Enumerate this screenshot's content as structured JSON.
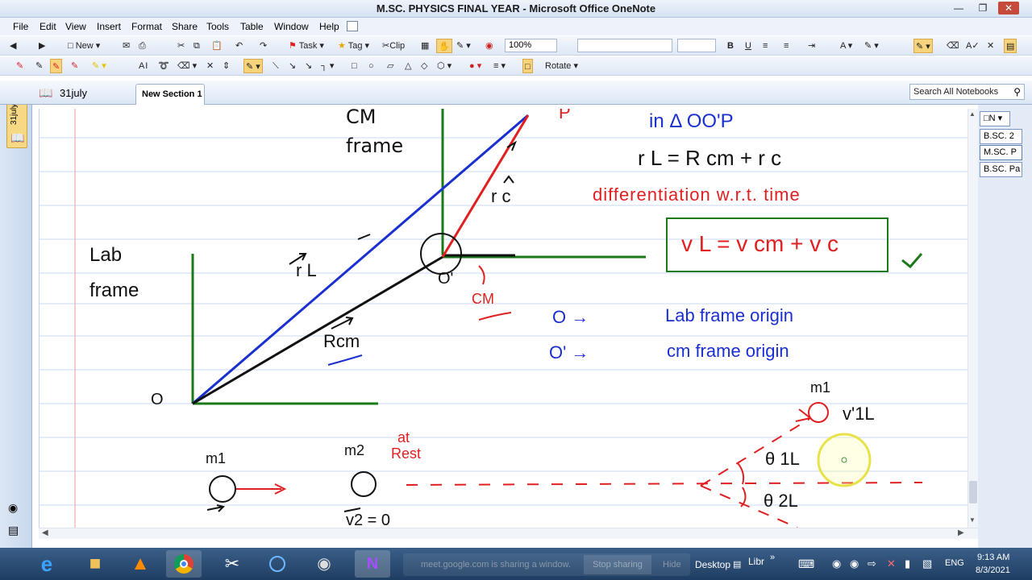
{
  "window": {
    "title": "M.SC. PHYSICS FINAL YEAR  - Microsoft Office OneNote"
  },
  "menu": [
    "File",
    "Edit",
    "View",
    "Insert",
    "Format",
    "Share",
    "Tools",
    "Table",
    "Window",
    "Help"
  ],
  "toolbar1": {
    "new_label": "New",
    "task_label": "Task",
    "tag_label": "Tag",
    "clip_label": "Clip",
    "zoom_value": "100%"
  },
  "toolbar2": {
    "rotate_label": "Rotate"
  },
  "notebook": {
    "name": "31july",
    "side_label": "31july"
  },
  "section_tab": "New Section 1",
  "search": {
    "placeholder": "Search All Notebooks"
  },
  "page_tabs": [
    "B.SC. 2",
    "M.SC. P",
    "B.SC. Pa"
  ],
  "page_tab_new": "N",
  "ink": {
    "cm_frame": [
      "CM",
      "frame"
    ],
    "lab_frame": [
      "Lab",
      "frame"
    ],
    "point_o": "O",
    "point_o_prime": "O'",
    "point_p": "P",
    "cm_label": "CM",
    "vec_rl": "r L",
    "vec_rc": "r c",
    "vec_rcm": "Rcm",
    "triangle_note": "in Δ OO'P",
    "eq_positions": "r L =  R cm  +  r c",
    "differentiation": "differentiation  w.r.t.  time",
    "eq_velocity": "v L =  v cm  +  v c",
    "legend_o": "O  →",
    "legend_o_text": "Lab frame origin",
    "legend_o1": "O'  →",
    "legend_o1_text": "cm frame origin",
    "m1": "m1",
    "m2": "m2",
    "at_rest": [
      "at",
      "Rest"
    ],
    "v2": "v2 = 0",
    "m1_right": "m1",
    "v1l": "v'1L",
    "theta1": "θ 1L",
    "theta2": "θ 2L"
  },
  "taskbar": {
    "share_notice": "meet.google.com is sharing a window.",
    "stop_sharing": "Stop sharing",
    "hide": "Hide",
    "desktop": "Desktop",
    "libr": "Libr",
    "lang": "ENG",
    "time": "9:13 AM",
    "date": "8/3/2021"
  },
  "colors": {
    "blue_ink": "#1a2fd0",
    "red_ink": "#e02020",
    "green_ink": "#1a7a1a",
    "rule_line": "#c9dbef",
    "margin_line": "#e89a9a"
  }
}
